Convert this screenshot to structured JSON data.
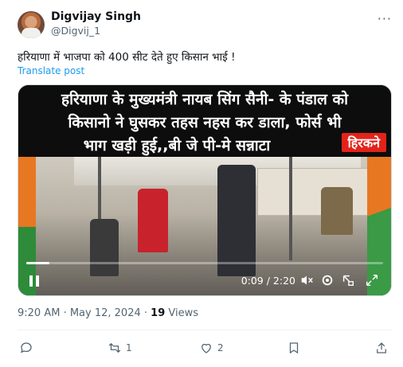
{
  "author": {
    "name": "Digvijay Singh",
    "handle": "@Digvij_1"
  },
  "tweet": {
    "text": "हरियाणा में भाजपा को 400 सीट देते हुए किसान भाई !",
    "translate_label": "Translate post"
  },
  "video": {
    "overlay_lines": [
      "हरियाणा के मुख्यमंत्री नायब सिंग सैनी- के पंडाल को",
      "किसानो ने घुसकर  तहस नहस कर डाला, फोर्स भी",
      "भाग खड़ी हुई,,बी जे पी-मे सन्नाटा"
    ],
    "overlay_tag": "हिरकने",
    "time_display": "0:09 / 2:20",
    "progress_fraction": 0.064
  },
  "meta": {
    "time": "9:20 AM",
    "date": "May 12, 2024",
    "views_count": "19",
    "views_label": "Views"
  },
  "actions": {
    "reply_count": "",
    "repost_count": "1",
    "like_count": "2"
  },
  "colors": {
    "accent": "#1d9bf0",
    "text": "#0f1419",
    "muted": "#536471",
    "tag": "#e2231a"
  },
  "icons": [
    "more-icon",
    "pause-icon",
    "mute-icon",
    "settings-icon",
    "picture-in-picture-icon",
    "fullscreen-icon",
    "reply-icon",
    "repost-icon",
    "like-icon",
    "bookmark-icon",
    "share-icon"
  ]
}
